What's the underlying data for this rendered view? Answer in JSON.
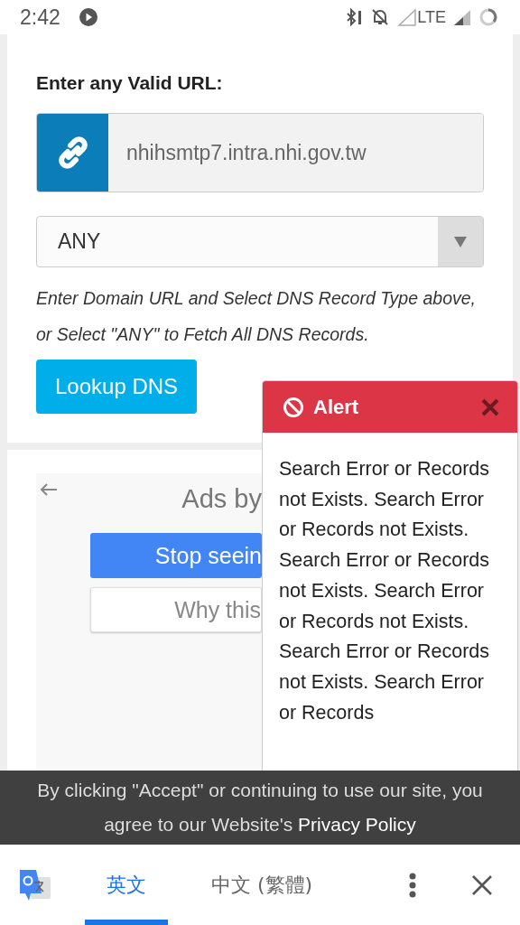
{
  "status_bar": {
    "time": "2:42",
    "network": "LTE"
  },
  "form": {
    "label": "Enter any Valid URL:",
    "url": "nhihsmtp7.intra.nhi.gov.tw",
    "record_type": "ANY",
    "help": "Enter Domain URL and Select DNS Record Type above, or Select \"ANY\" to Fetch All DNS Records.",
    "button": "Lookup DNS"
  },
  "ad": {
    "title": "Ads by",
    "buttons": [
      {
        "label": "Stop seein",
        "kind": "primary"
      },
      {
        "label": "Why this",
        "kind": "secondary"
      }
    ]
  },
  "alert": {
    "title": "Alert",
    "message": "Search Error or Records not Exists. Search Error or Records not Exists. Search Error or Records not Exists. Search Error or Records not Exists. Search Error or Records not Exists. Search Error or Records"
  },
  "cookie_banner": {
    "text": "By clicking \"Accept\" or continuing to use our site, you agree to our Website's",
    "link": "Privacy Policy"
  },
  "translate_bar": {
    "tabs": [
      {
        "label": "英文",
        "selected": true
      },
      {
        "label": "中文 (繁體)",
        "selected": false
      }
    ]
  }
}
